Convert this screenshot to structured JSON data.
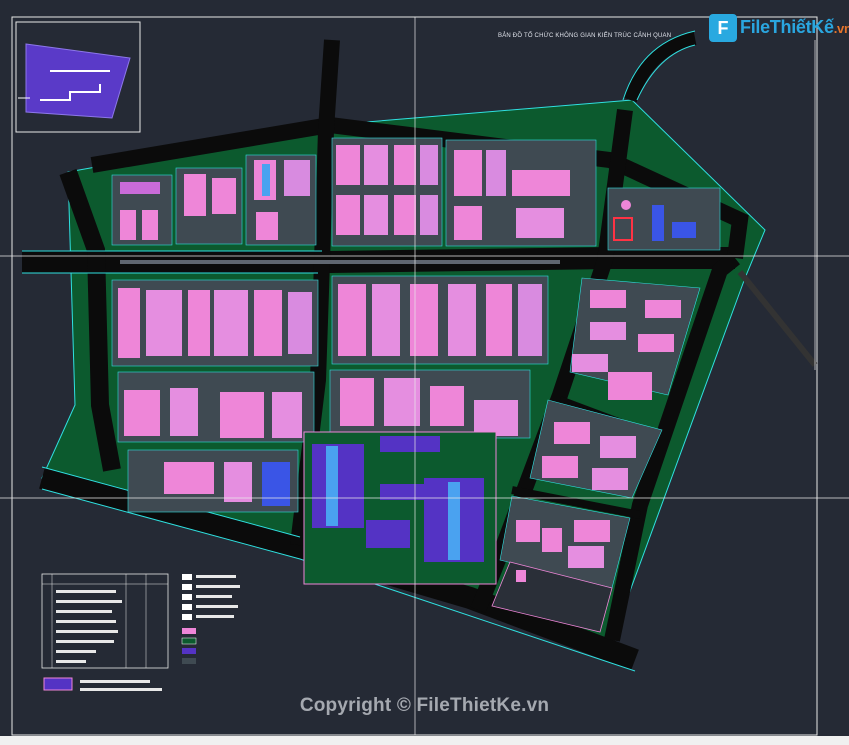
{
  "logo": {
    "letter": "F",
    "brand": "FileThiếtKế",
    "tld": ".vn"
  },
  "copyright": "Copyright © FileThietKe.vn",
  "sheet_title": "BẢN ĐỒ TỔ CHỨC KHÔNG GIAN KIẾN TRÚC CẢNH QUAN",
  "colors": {
    "background": "#252a35",
    "road": "#0a0a0a",
    "green": "#0c5a2e",
    "block": "#3f4a52",
    "building": "#ee86d8",
    "warehouse": "#5433c4",
    "frame": "#2fe0e0"
  }
}
